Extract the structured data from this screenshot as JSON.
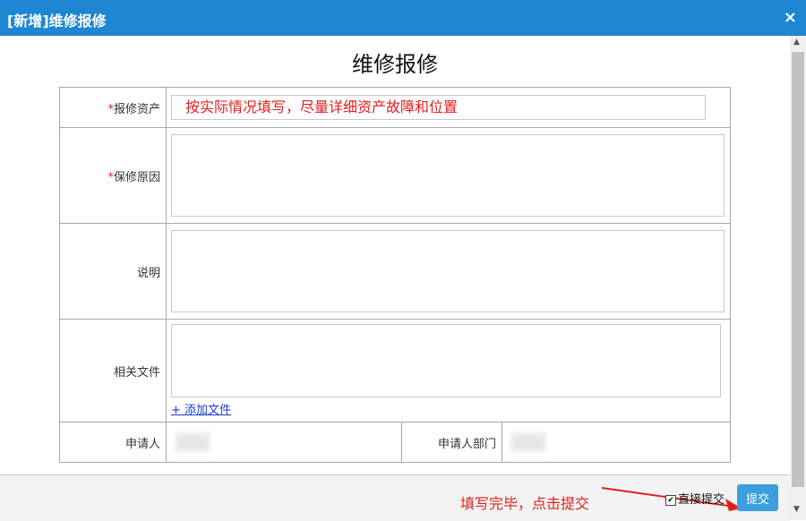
{
  "dialog": {
    "title": "[新增]维修报修",
    "close_label": "×"
  },
  "form": {
    "title": "维修报修",
    "asset": {
      "required_mark": "*",
      "label": "报修资产",
      "value": "按实际情况填写，尽量详细资产故障和位置"
    },
    "reason": {
      "required_mark": "*",
      "label": "保修原因"
    },
    "desc": {
      "label": "说明"
    },
    "files": {
      "label": "相关文件",
      "add_label": "+ 添加文件"
    },
    "applicant": {
      "label": "申请人"
    },
    "dept": {
      "label": "申请人部门"
    }
  },
  "footer": {
    "annotation": "填写完毕，点击提交",
    "direct_submit": {
      "label": "直接提交",
      "checked": true
    },
    "submit_label": "提交"
  },
  "colors": {
    "titlebar": "#1e86d3",
    "accent_red": "#e02020",
    "submit": "#3b9ede"
  },
  "icons": {
    "close": "close-icon",
    "checkbox": "checkbox-icon",
    "arrow": "arrow-icon"
  }
}
